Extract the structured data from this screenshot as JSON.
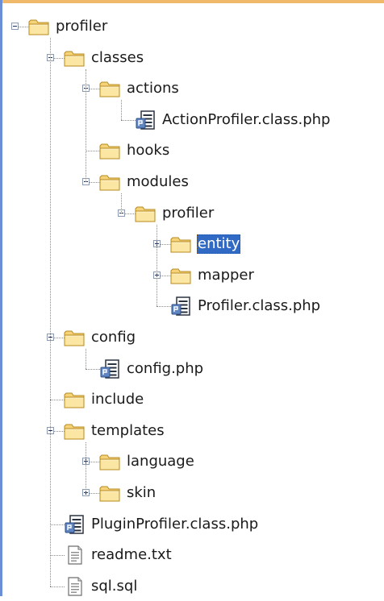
{
  "window": {
    "border_color": "#f0b86a",
    "left_border_color": "#6b8fd6"
  },
  "tree": {
    "selected_color": "#316ac5",
    "root": {
      "label": "profiler",
      "icon": "folder-icon",
      "state": "expanded",
      "children": [
        {
          "label": "classes",
          "icon": "folder-icon",
          "state": "expanded",
          "children": [
            {
              "label": "actions",
              "icon": "folder-icon",
              "state": "expanded",
              "children": [
                {
                  "label": "ActionProfiler.class.php",
                  "icon": "php-file-icon"
                }
              ]
            },
            {
              "label": "hooks",
              "icon": "folder-icon"
            },
            {
              "label": "modules",
              "icon": "folder-icon",
              "state": "expanded",
              "children": [
                {
                  "label": "profiler",
                  "icon": "folder-icon",
                  "state": "expanded",
                  "children": [
                    {
                      "label": "entity",
                      "icon": "folder-icon",
                      "state": "collapsed",
                      "selected": true
                    },
                    {
                      "label": "mapper",
                      "icon": "folder-icon",
                      "state": "collapsed"
                    },
                    {
                      "label": "Profiler.class.php",
                      "icon": "php-file-icon"
                    }
                  ]
                }
              ]
            }
          ]
        },
        {
          "label": "config",
          "icon": "folder-icon",
          "state": "expanded",
          "children": [
            {
              "label": "config.php",
              "icon": "php-file-icon"
            }
          ]
        },
        {
          "label": "include",
          "icon": "folder-icon"
        },
        {
          "label": "templates",
          "icon": "folder-icon",
          "state": "expanded",
          "children": [
            {
              "label": "language",
              "icon": "folder-icon",
              "state": "collapsed"
            },
            {
              "label": "skin",
              "icon": "folder-icon",
              "state": "collapsed"
            }
          ]
        },
        {
          "label": "PluginProfiler.class.php",
          "icon": "php-file-icon"
        },
        {
          "label": "readme.txt",
          "icon": "text-file-icon"
        },
        {
          "label": "sql.sql",
          "icon": "text-file-icon"
        }
      ]
    }
  }
}
